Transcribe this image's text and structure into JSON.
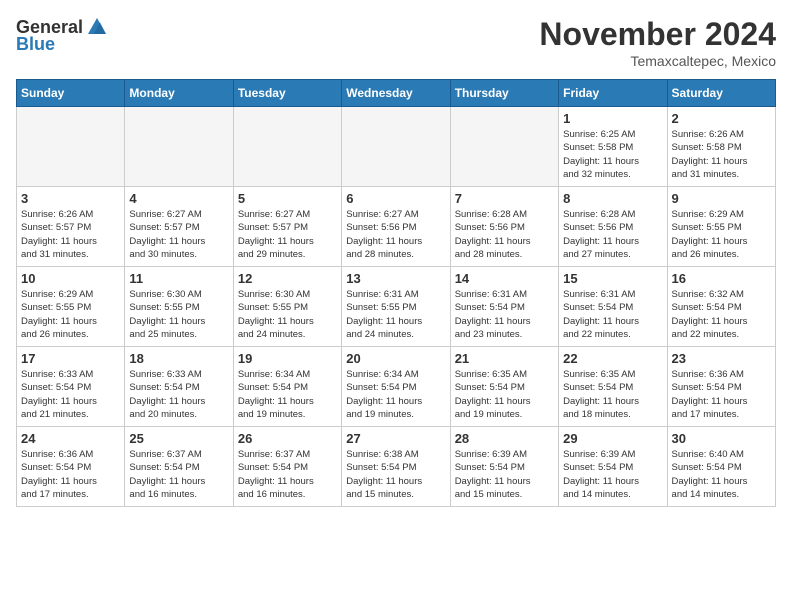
{
  "header": {
    "logo_general": "General",
    "logo_blue": "Blue",
    "month_title": "November 2024",
    "location": "Temaxcaltepec, Mexico"
  },
  "weekdays": [
    "Sunday",
    "Monday",
    "Tuesday",
    "Wednesday",
    "Thursday",
    "Friday",
    "Saturday"
  ],
  "weeks": [
    [
      {
        "day": "",
        "info": ""
      },
      {
        "day": "",
        "info": ""
      },
      {
        "day": "",
        "info": ""
      },
      {
        "day": "",
        "info": ""
      },
      {
        "day": "",
        "info": ""
      },
      {
        "day": "1",
        "info": "Sunrise: 6:25 AM\nSunset: 5:58 PM\nDaylight: 11 hours\nand 32 minutes."
      },
      {
        "day": "2",
        "info": "Sunrise: 6:26 AM\nSunset: 5:58 PM\nDaylight: 11 hours\nand 31 minutes."
      }
    ],
    [
      {
        "day": "3",
        "info": "Sunrise: 6:26 AM\nSunset: 5:57 PM\nDaylight: 11 hours\nand 31 minutes."
      },
      {
        "day": "4",
        "info": "Sunrise: 6:27 AM\nSunset: 5:57 PM\nDaylight: 11 hours\nand 30 minutes."
      },
      {
        "day": "5",
        "info": "Sunrise: 6:27 AM\nSunset: 5:57 PM\nDaylight: 11 hours\nand 29 minutes."
      },
      {
        "day": "6",
        "info": "Sunrise: 6:27 AM\nSunset: 5:56 PM\nDaylight: 11 hours\nand 28 minutes."
      },
      {
        "day": "7",
        "info": "Sunrise: 6:28 AM\nSunset: 5:56 PM\nDaylight: 11 hours\nand 28 minutes."
      },
      {
        "day": "8",
        "info": "Sunrise: 6:28 AM\nSunset: 5:56 PM\nDaylight: 11 hours\nand 27 minutes."
      },
      {
        "day": "9",
        "info": "Sunrise: 6:29 AM\nSunset: 5:55 PM\nDaylight: 11 hours\nand 26 minutes."
      }
    ],
    [
      {
        "day": "10",
        "info": "Sunrise: 6:29 AM\nSunset: 5:55 PM\nDaylight: 11 hours\nand 26 minutes."
      },
      {
        "day": "11",
        "info": "Sunrise: 6:30 AM\nSunset: 5:55 PM\nDaylight: 11 hours\nand 25 minutes."
      },
      {
        "day": "12",
        "info": "Sunrise: 6:30 AM\nSunset: 5:55 PM\nDaylight: 11 hours\nand 24 minutes."
      },
      {
        "day": "13",
        "info": "Sunrise: 6:31 AM\nSunset: 5:55 PM\nDaylight: 11 hours\nand 24 minutes."
      },
      {
        "day": "14",
        "info": "Sunrise: 6:31 AM\nSunset: 5:54 PM\nDaylight: 11 hours\nand 23 minutes."
      },
      {
        "day": "15",
        "info": "Sunrise: 6:31 AM\nSunset: 5:54 PM\nDaylight: 11 hours\nand 22 minutes."
      },
      {
        "day": "16",
        "info": "Sunrise: 6:32 AM\nSunset: 5:54 PM\nDaylight: 11 hours\nand 22 minutes."
      }
    ],
    [
      {
        "day": "17",
        "info": "Sunrise: 6:33 AM\nSunset: 5:54 PM\nDaylight: 11 hours\nand 21 minutes."
      },
      {
        "day": "18",
        "info": "Sunrise: 6:33 AM\nSunset: 5:54 PM\nDaylight: 11 hours\nand 20 minutes."
      },
      {
        "day": "19",
        "info": "Sunrise: 6:34 AM\nSunset: 5:54 PM\nDaylight: 11 hours\nand 19 minutes."
      },
      {
        "day": "20",
        "info": "Sunrise: 6:34 AM\nSunset: 5:54 PM\nDaylight: 11 hours\nand 19 minutes."
      },
      {
        "day": "21",
        "info": "Sunrise: 6:35 AM\nSunset: 5:54 PM\nDaylight: 11 hours\nand 19 minutes."
      },
      {
        "day": "22",
        "info": "Sunrise: 6:35 AM\nSunset: 5:54 PM\nDaylight: 11 hours\nand 18 minutes."
      },
      {
        "day": "23",
        "info": "Sunrise: 6:36 AM\nSunset: 5:54 PM\nDaylight: 11 hours\nand 17 minutes."
      }
    ],
    [
      {
        "day": "24",
        "info": "Sunrise: 6:36 AM\nSunset: 5:54 PM\nDaylight: 11 hours\nand 17 minutes."
      },
      {
        "day": "25",
        "info": "Sunrise: 6:37 AM\nSunset: 5:54 PM\nDaylight: 11 hours\nand 16 minutes."
      },
      {
        "day": "26",
        "info": "Sunrise: 6:37 AM\nSunset: 5:54 PM\nDaylight: 11 hours\nand 16 minutes."
      },
      {
        "day": "27",
        "info": "Sunrise: 6:38 AM\nSunset: 5:54 PM\nDaylight: 11 hours\nand 15 minutes."
      },
      {
        "day": "28",
        "info": "Sunrise: 6:39 AM\nSunset: 5:54 PM\nDaylight: 11 hours\nand 15 minutes."
      },
      {
        "day": "29",
        "info": "Sunrise: 6:39 AM\nSunset: 5:54 PM\nDaylight: 11 hours\nand 14 minutes."
      },
      {
        "day": "30",
        "info": "Sunrise: 6:40 AM\nSunset: 5:54 PM\nDaylight: 11 hours\nand 14 minutes."
      }
    ]
  ]
}
